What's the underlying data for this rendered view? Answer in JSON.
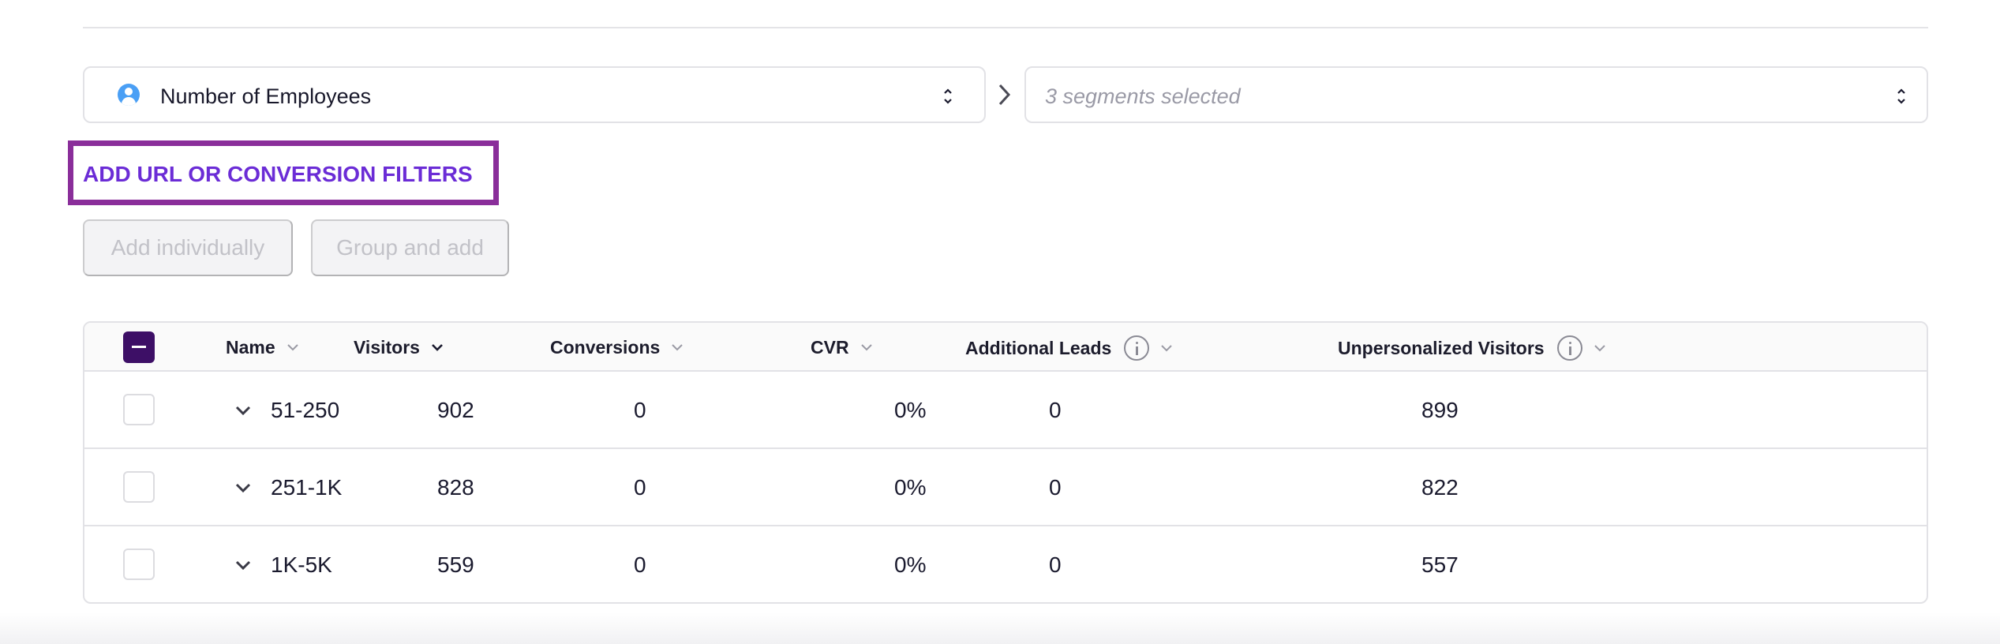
{
  "filters": {
    "dimension_label": "Number of Employees",
    "segments_placeholder": "3 segments selected"
  },
  "filter_link": "ADD URL OR CONVERSION FILTERS",
  "buttons": {
    "add_individually": "Add individually",
    "group_and_add": "Group and add"
  },
  "table": {
    "columns": [
      "Name",
      "Visitors",
      "Conversions",
      "CVR",
      "Additional Leads",
      "Unpersonalized Visitors"
    ],
    "rows": [
      {
        "name": "51-250",
        "visitors": "902",
        "conversions": "0",
        "cvr": "0%",
        "additional_leads": "0",
        "unpersonalized_visitors": "899"
      },
      {
        "name": "251-1K",
        "visitors": "828",
        "conversions": "0",
        "cvr": "0%",
        "additional_leads": "0",
        "unpersonalized_visitors": "822"
      },
      {
        "name": "1K-5K",
        "visitors": "559",
        "conversions": "0",
        "cvr": "0%",
        "additional_leads": "0",
        "unpersonalized_visitors": "557"
      }
    ]
  },
  "colors": {
    "accent_purple": "#6b2cd6",
    "highlight_border": "#8a2e9a",
    "checkbox_dark": "#3d0f66",
    "person_icon_blue": "#4a9ff5"
  },
  "icons": [
    "person-icon",
    "updown-icon",
    "chevron-right-icon",
    "chevron-down-icon",
    "info-icon",
    "minus-icon"
  ]
}
